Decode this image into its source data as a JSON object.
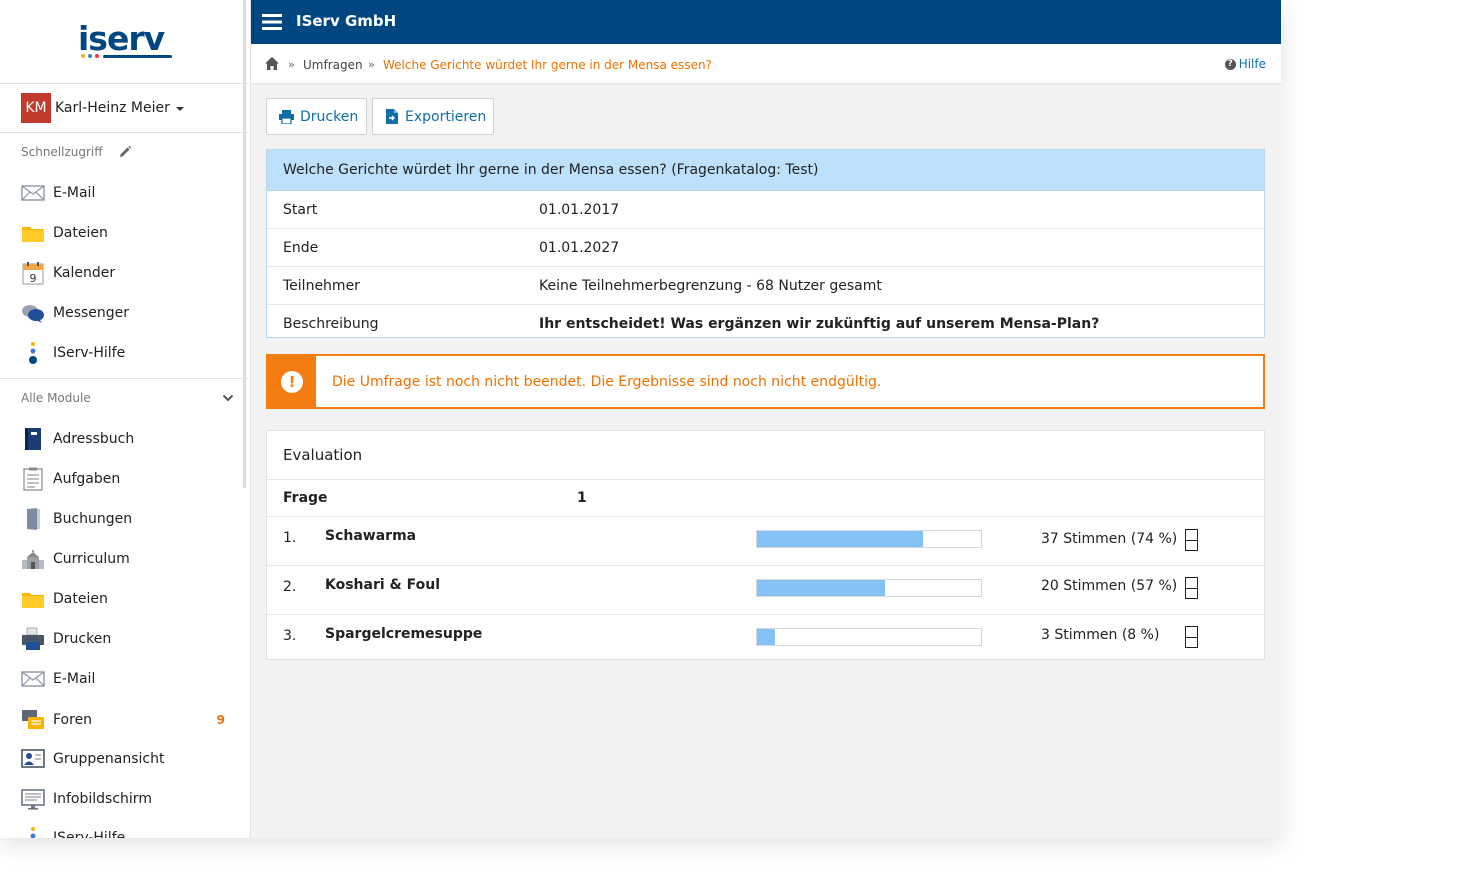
{
  "brand": {
    "logo_text": "iserv",
    "org_name": "IServ GmbH"
  },
  "user": {
    "initials": "KM",
    "name": "Karl-Heinz Meier"
  },
  "quick_access": {
    "label": "Schnellzugriff",
    "items": [
      {
        "label": "E-Mail",
        "icon": "mail-icon"
      },
      {
        "label": "Dateien",
        "icon": "folder-icon"
      },
      {
        "label": "Kalender",
        "icon": "calendar-icon"
      },
      {
        "label": "Messenger",
        "icon": "messenger-icon"
      },
      {
        "label": "IServ-Hilfe",
        "icon": "help-dots-icon"
      }
    ]
  },
  "all_modules": {
    "label": "Alle Module",
    "items": [
      {
        "label": "Adressbuch",
        "icon": "address-book-icon"
      },
      {
        "label": "Aufgaben",
        "icon": "tasks-icon"
      },
      {
        "label": "Buchungen",
        "icon": "door-icon"
      },
      {
        "label": "Curriculum",
        "icon": "school-icon"
      },
      {
        "label": "Dateien",
        "icon": "folder-icon"
      },
      {
        "label": "Drucken",
        "icon": "printer-icon"
      },
      {
        "label": "E-Mail",
        "icon": "mail-icon"
      },
      {
        "label": "Foren",
        "icon": "forum-icon",
        "badge": "9"
      },
      {
        "label": "Gruppenansicht",
        "icon": "group-view-icon"
      },
      {
        "label": "Infobildschirm",
        "icon": "info-screen-icon"
      },
      {
        "label": "IServ-Hilfe",
        "icon": "help-dots-icon"
      }
    ]
  },
  "breadcrumb": {
    "parent": "Umfragen",
    "current": "Welche Gerichte würdet Ihr gerne in der Mensa essen?",
    "separator": "»"
  },
  "help_label": "Hilfe",
  "actions": {
    "print": "Drucken",
    "export": "Exportieren"
  },
  "survey": {
    "heading": "Welche Gerichte würdet Ihr gerne in der Mensa essen? (Fragenkatalog: Test)",
    "rows": [
      {
        "key": "Start",
        "value": "01.01.2017"
      },
      {
        "key": "Ende",
        "value": "01.01.2027"
      },
      {
        "key": "Teilnehmer",
        "value": "Keine Teilnehmerbegrenzung - 68 Nutzer gesamt"
      },
      {
        "key": "Beschreibung",
        "value": "Ihr entscheidet! Was ergänzen wir zukünftig auf unserem Mensa-Plan?"
      }
    ]
  },
  "alert": {
    "text": "Die Umfrage ist noch nicht beendet. Die Ergebnisse sind noch nicht endgültig."
  },
  "evaluation": {
    "title": "Evaluation",
    "question_label": "Frage",
    "question_number": "1",
    "answers": [
      {
        "num": "1.",
        "label": "Schawarma",
        "votes_text": "37 Stimmen (74 %)",
        "percent": 74
      },
      {
        "num": "2.",
        "label": "Koshari & Foul",
        "votes_text": "20 Stimmen (57 %)",
        "percent": 57
      },
      {
        "num": "3.",
        "label": "Spargelcremesuppe",
        "votes_text": "3 Stimmen (8 %)",
        "percent": 8
      }
    ]
  },
  "colors": {
    "header": "#004680",
    "accent": "#ee7100",
    "link": "#0d6ea8",
    "bar": "#84c2f5"
  }
}
